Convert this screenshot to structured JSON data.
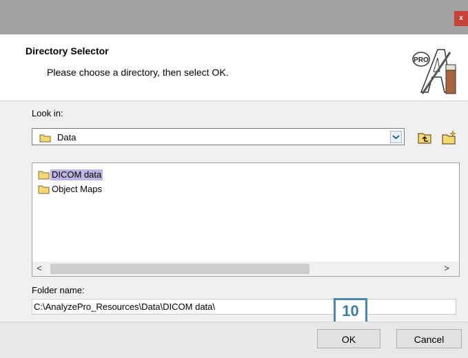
{
  "window": {
    "close_glyph": "x"
  },
  "header": {
    "title": "Directory Selector",
    "subtitle": "Please choose a directory, then select OK.",
    "logo_text": "PRO"
  },
  "look_in": {
    "label": "Look in:",
    "value": "Data"
  },
  "list": {
    "items": [
      {
        "label": "DICOM data",
        "selected": true
      },
      {
        "label": "Object Maps",
        "selected": false
      }
    ],
    "scroll_left": "<",
    "scroll_right": ">"
  },
  "folder_name": {
    "label": "Folder name:",
    "value": "C:\\AnalyzePro_Resources\\Data\\DICOM data\\"
  },
  "annotation": {
    "step": "10"
  },
  "buttons": {
    "ok": "OK",
    "cancel": "Cancel"
  },
  "colors": {
    "selection": "#bdb4e3",
    "close": "#c7433a",
    "badge": "#4a87ac",
    "folder": "#f5d775"
  }
}
